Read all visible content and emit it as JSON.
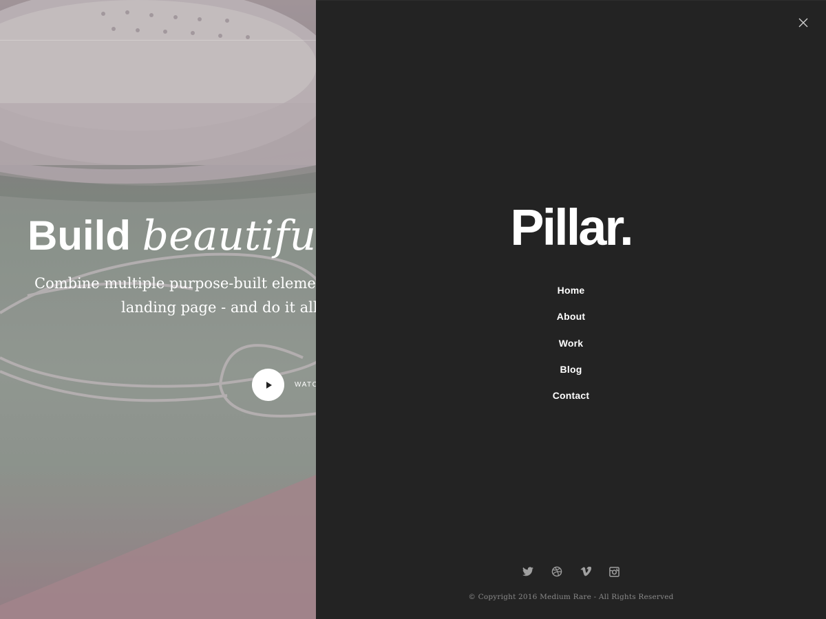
{
  "hero": {
    "title_bold": "Build",
    "title_italic": "beautiful l",
    "subtitle_line1": "Combine multiple purpose-built elements",
    "subtitle_line2": "landing page - and do it all in",
    "video_label": "WATC"
  },
  "overlay": {
    "logo": "Pillar.",
    "menu": [
      {
        "label": "Home"
      },
      {
        "label": "About"
      },
      {
        "label": "Work"
      },
      {
        "label": "Blog"
      },
      {
        "label": "Contact"
      }
    ],
    "social_icons": [
      "twitter-icon",
      "dribbble-icon",
      "vimeo-icon",
      "instagram-icon"
    ],
    "copyright": "© Copyright 2016 Medium Rare - All Rights Reserved"
  },
  "colors": {
    "panel_bg": "#232323",
    "text": "#ffffff",
    "muted": "#8a8a8a"
  }
}
